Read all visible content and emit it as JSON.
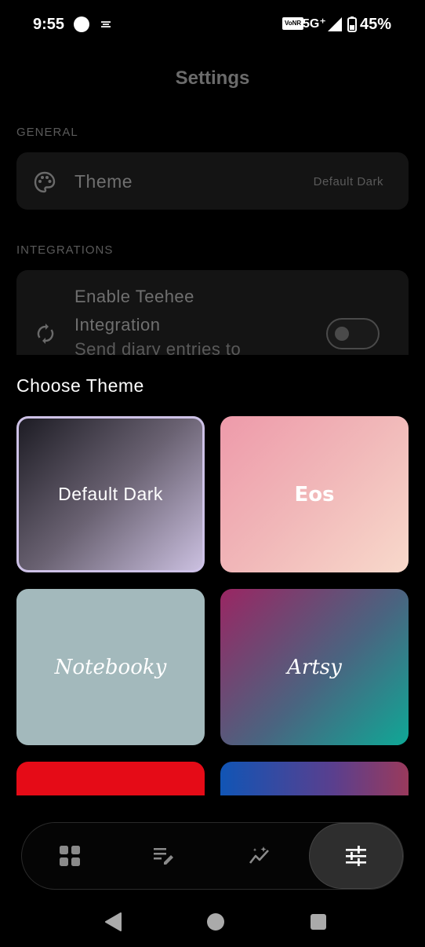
{
  "status_bar": {
    "time": "9:55",
    "volte": "VoNR",
    "network": "5G⁺",
    "battery": "45%"
  },
  "settings": {
    "title": "Settings",
    "general_section": "GENERAL",
    "theme_label": "Theme",
    "theme_value": "Default Dark",
    "integrations_section": "INTEGRATIONS",
    "integration_title": "Enable Teehee Integration",
    "integration_subtitle": "Send diary entries to",
    "integration_enabled": false
  },
  "theme_sheet": {
    "title": "Choose Theme",
    "selected": "Default Dark",
    "themes": [
      {
        "name": "Default Dark"
      },
      {
        "name": "Eos"
      },
      {
        "name": "Notebooky"
      },
      {
        "name": "Artsy"
      }
    ]
  },
  "bottom_nav": {
    "items": [
      "grid-icon",
      "edit-list-icon",
      "insights-icon",
      "tune-icon"
    ],
    "active": "tune-icon"
  },
  "colors": {
    "background": "#000000",
    "selected_border": "#cdc1e6",
    "eos": "#f1b8b9",
    "notebooky": "#a3b9bc",
    "red_theme": "#e50b17"
  }
}
